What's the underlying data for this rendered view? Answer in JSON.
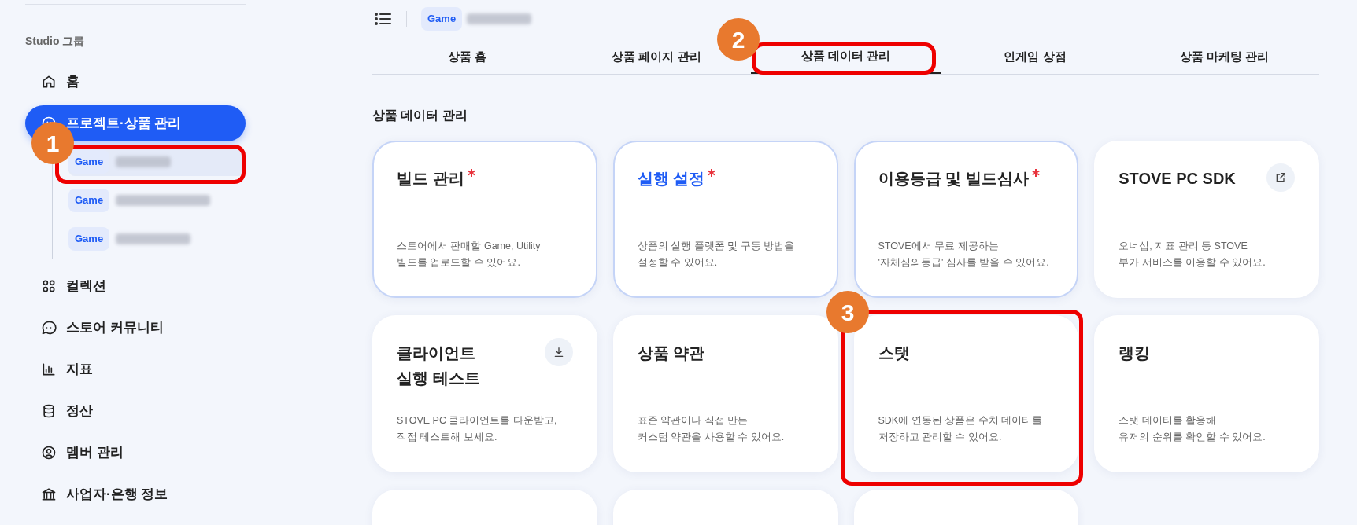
{
  "sidebar": {
    "group_label": "Studio 그룹",
    "items": [
      {
        "label": "홈",
        "selected": false
      },
      {
        "label": "프로젝트·상품 관리",
        "selected": true,
        "children": [
          {
            "badge": "Game",
            "selected": true
          },
          {
            "badge": "Game",
            "selected": false
          },
          {
            "badge": "Game",
            "selected": false
          }
        ]
      },
      {
        "label": "컬렉션",
        "selected": false
      },
      {
        "label": "스토어 커뮤니티",
        "selected": false
      },
      {
        "label": "지표",
        "selected": false
      },
      {
        "label": "정산",
        "selected": false
      },
      {
        "label": "멤버 관리",
        "selected": false
      },
      {
        "label": "사업자·은행 정보",
        "selected": false
      }
    ]
  },
  "breadcrumb": {
    "badge": "Game"
  },
  "tabs": [
    {
      "label": "상품 홈",
      "selected": false
    },
    {
      "label": "상품 페이지 관리",
      "selected": false
    },
    {
      "label": "상품 데이터 관리",
      "selected": true
    },
    {
      "label": "인게임 상점",
      "selected": false
    },
    {
      "label": "상품 마케팅 관리",
      "selected": false
    }
  ],
  "section_title": "상품 데이터 관리",
  "cards": [
    {
      "kind": "plain",
      "title": "빌드 관리",
      "required": true,
      "highlighted": true,
      "active": false,
      "description": "스토어에서 판매할 Game, Utility\n빌드를 업로드할 수 있어요."
    },
    {
      "kind": "plain",
      "title": "실행 설정",
      "required": true,
      "highlighted": true,
      "active": true,
      "description": "상품의 실행 플랫폼 및 구동 방법을\n설정할 수 있어요."
    },
    {
      "kind": "plain",
      "title": "이용등급 및 빌드심사",
      "required": true,
      "highlighted": true,
      "active": false,
      "description": "STOVE에서 무료 제공하는\n'자체심의등급' 심사를 받을 수 있어요."
    },
    {
      "kind": "external",
      "title": "STOVE PC SDK",
      "required": false,
      "highlighted": false,
      "active": false,
      "description": "오너십, 지표 관리 등 STOVE\n부가 서비스를 이용할 수 있어요."
    },
    {
      "kind": "download",
      "title": "클라이언트\n실행 테스트",
      "required": false,
      "highlighted": false,
      "active": false,
      "description": "STOVE PC 클라이언트를 다운받고,\n직접 테스트해 보세요."
    },
    {
      "kind": "plain",
      "title": "상품 약관",
      "required": false,
      "highlighted": false,
      "active": false,
      "description": "표준 약관이나 직접 만든\n커스텀 약관을 사용할 수 있어요."
    },
    {
      "kind": "plain",
      "title": "스탯",
      "required": false,
      "highlighted": false,
      "active": false,
      "description": "SDK에 연동된 상품은 수치 데이터를\n저장하고 관리할 수 있어요."
    },
    {
      "kind": "plain",
      "title": "랭킹",
      "required": false,
      "highlighted": false,
      "active": false,
      "description": "스탯 데이터를 활용해\n유저의 순위를 확인할 수 있어요."
    },
    {
      "kind": "cut"
    },
    {
      "kind": "cut"
    },
    {
      "kind": "cut"
    }
  ],
  "callouts": [
    {
      "number": "1"
    },
    {
      "number": "2"
    },
    {
      "number": "3"
    }
  ]
}
